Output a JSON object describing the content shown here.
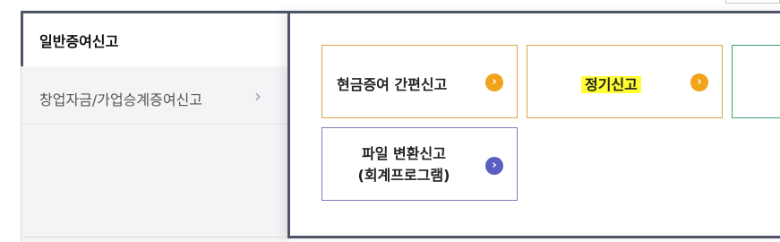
{
  "tabs": {
    "active_label": "일반증여신고",
    "items": [
      {
        "label": "창업자금/가업승계증여신고",
        "chevron": "›"
      }
    ]
  },
  "buttons": [
    {
      "label": "현금증여 간편신고",
      "icon": "chevron-right-circle-icon",
      "color": "#f2a31b"
    },
    {
      "label": "정기신고",
      "icon": "chevron-right-circle-icon",
      "color": "#f2a31b",
      "highlight": "#ffff33"
    },
    {
      "label": "파일 변환신고\n(회계프로그램)",
      "line1": "파일 변환신고",
      "line2": "(회계프로그램)",
      "icon": "chevron-right-circle-icon",
      "color": "#5b5fc1"
    }
  ],
  "accent_colors": {
    "frame": "#4e5567",
    "orange_border": "#d7a849",
    "green_border": "#3aa46e",
    "purple_border": "#7b7fb8"
  }
}
